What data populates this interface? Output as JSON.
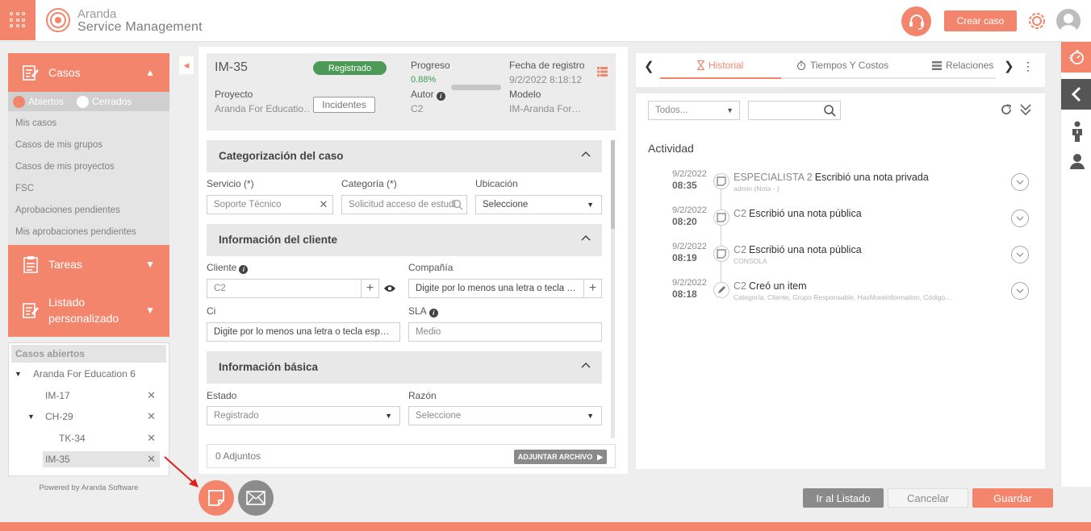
{
  "header": {
    "brand_line1": "Aranda",
    "brand_line2": "Service Management",
    "create_case": "Crear caso",
    "accent": "#f4856d"
  },
  "sidebar": {
    "casos": "Casos",
    "filter_open": "Abiertos",
    "filter_closed": "Cerrados",
    "links": [
      "Mis casos",
      "Casos de mis grupos",
      "Casos de mis proyectos",
      "FSC",
      "Aprobaciones pendientes",
      "Mis aprobaciones pendientes"
    ],
    "tareas": "Tareas",
    "listado_line1": "Listado",
    "listado_line2": "personalizado",
    "open_cases_title": "Casos abiertos",
    "tree": {
      "root": "Aranda For Education 6",
      "items": [
        "IM-17",
        "CH-29",
        "TK-34",
        "IM-35"
      ]
    },
    "powered": "Powered by Aranda Software"
  },
  "case": {
    "id": "IM-35",
    "status": "Registrado",
    "progress_label": "Progreso",
    "progress_value": "0.88%",
    "progress_fraction": 0.0088,
    "date_label": "Fecha de registro",
    "date_value": "9/2/2022 8:18:12",
    "project_label": "Proyecto",
    "project_value": "Aranda For Educatio…",
    "type_value": "Incidentes",
    "author_label": "Autor",
    "author_value": "C2",
    "model_label": "Modelo",
    "model_value": "IM-Aranda For…"
  },
  "sections": {
    "categorization": "Categorización del caso",
    "client": "Información del cliente",
    "basic": "Información básica"
  },
  "fields": {
    "servicio_label": "Servicio (*)",
    "servicio_value": "Soporte Técnico",
    "categoria_label": "Categoría (*)",
    "categoria_placeholder": "Solicitud acceso de estudi",
    "ubicacion_label": "Ubicación",
    "ubicacion_value": "Seleccione",
    "cliente_label": "Cliente",
    "cliente_value": "C2",
    "compania_label": "Compañía",
    "compania_placeholder": "Digite por lo menos una letra o tecla …",
    "ci_label": "Ci",
    "ci_placeholder": "Digite por lo menos una letra o tecla esp…",
    "sla_label": "SLA",
    "sla_value": "Medio",
    "estado_label": "Estado",
    "estado_value": "Registrado",
    "razon_label": "Razón",
    "razon_value": "Seleccione"
  },
  "attachments": {
    "count_text": "0 Adjuntos",
    "button": "ADJUNTAR ARCHIVO"
  },
  "right_panel": {
    "tabs": [
      "Historial",
      "Tiempos Y Costos",
      "Relaciones"
    ],
    "filter_value": "Todos...",
    "activity_title": "Actividad",
    "entries": [
      {
        "date": "9/2/2022",
        "time": "08:35",
        "who": "ESPECIALISTA 2",
        "action": "Escribió una nota privada",
        "sub": "admin (Nota - )"
      },
      {
        "date": "9/2/2022",
        "time": "08:20",
        "who": "C2",
        "action": "Escribió una nota pública",
        "sub": ""
      },
      {
        "date": "9/2/2022",
        "time": "08:19",
        "who": "C2",
        "action": "Escribió una nota pública",
        "sub": "CONSOLA"
      },
      {
        "date": "9/2/2022",
        "time": "08:18",
        "who": "C2",
        "action": "Creó un item",
        "sub": "Categoría, Cliente, Grupo Responsable, HasMoreInformation, Código…"
      }
    ]
  },
  "buttons": {
    "go_list": "Ir al Listado",
    "cancel": "Cancelar",
    "save": "Guardar"
  }
}
